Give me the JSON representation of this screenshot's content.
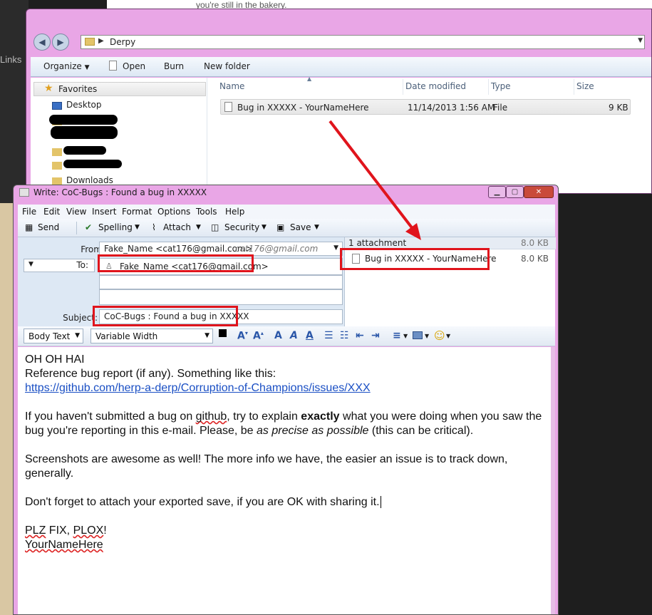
{
  "background": {
    "links_label": "Links",
    "page_text": "you're still in the bakery."
  },
  "explorer": {
    "back_icon": "back-arrow-icon",
    "forward_icon": "forward-arrow-icon",
    "path": "Derpy",
    "toolbar": {
      "organize": "Organize",
      "open": "Open",
      "burn": "Burn",
      "new_folder": "New folder"
    },
    "nav": {
      "favorites": "Favorites",
      "desktop": "Desktop",
      "downloads": "Downloads"
    },
    "columns": {
      "name": "Name",
      "date": "Date modified",
      "type": "Type",
      "size": "Size"
    },
    "file": {
      "name": "Bug in XXXXX - YourNameHere",
      "date": "11/14/2013 1:56 AM",
      "type": "File",
      "size": "9 KB"
    }
  },
  "compose": {
    "title": "Write: CoC-Bugs : Found a bug in XXXXX",
    "menu": [
      "File",
      "Edit",
      "View",
      "Insert",
      "Format",
      "Options",
      "Tools",
      "Help"
    ],
    "toolbar": {
      "send": "Send",
      "spelling": "Spelling",
      "attach": "Attach",
      "security": "Security",
      "save": "Save"
    },
    "from_label": "From:",
    "from_value": "Fake_Name <cat176@gmail.com>",
    "from_account": "cat176@gmail.com",
    "to_label": "To:",
    "to_value": "Fake_Name <cat176@gmail.com>",
    "subject_label": "Subject:",
    "subject_value": "CoC-Bugs : Found a bug in XXXXX",
    "attachments_header": "1 attachment",
    "attachments_total": "8.0 KB",
    "attachment_name": "Bug in XXXXX - YourNameHere",
    "attachment_size": "8.0 KB",
    "format": {
      "paragraph": "Body Text",
      "font": "Variable Width"
    },
    "body": {
      "l1": "OH HAI",
      "l2": "Reference bug report (if any). Something like this:",
      "link": "https://github.com/herp-a-derp/Corruption-of-Champions/issues/XXX",
      "p2a": "If you haven't submitted a bug on ",
      "p2b": "github",
      "p2c": ", try to explain ",
      "p2d": "exactly",
      "p2e": " what you were doing when you saw the bug you're reporting in this e-mail. Please, be ",
      "p2f": "as precise as possible",
      "p2g": " (this can be critical).",
      "p3": "Screenshots are awesome as well! The more info we have, the easier an issue is to track down, generally.",
      "p4": "Don't forget to attach your exported save, if you are OK with sharing it.",
      "p5a": "PLZ",
      "p5b": " FIX, ",
      "p5c": "PLOX",
      "p5d": "!",
      "p6": "YourNameHere"
    }
  },
  "colors": {
    "highlight": "#e0141c",
    "window_frame": "#e9a6e6",
    "link": "#1a4fc4"
  }
}
